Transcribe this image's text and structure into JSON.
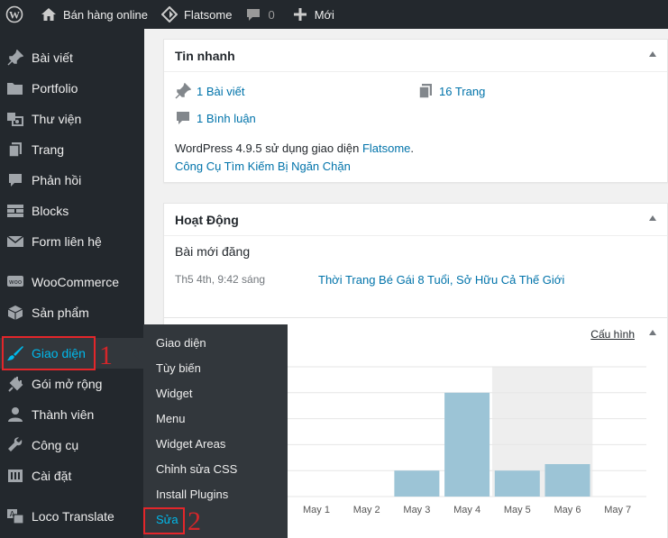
{
  "admin_bar": {
    "site_name": "Bán hàng online",
    "theme": "Flatsome",
    "comments_count": "0",
    "new_label": "Mới"
  },
  "sidebar": {
    "items": [
      {
        "label": "Bài viết",
        "icon": "pin-icon"
      },
      {
        "label": "Portfolio",
        "icon": "folder-icon"
      },
      {
        "label": "Thư viện",
        "icon": "media-icon"
      },
      {
        "label": "Trang",
        "icon": "pages-icon"
      },
      {
        "label": "Phản hồi",
        "icon": "comment-icon"
      },
      {
        "label": "Blocks",
        "icon": "blocks-icon"
      },
      {
        "label": "Form liên hệ",
        "icon": "mail-icon"
      },
      {
        "label": "WooCommerce",
        "icon": "woo-icon"
      },
      {
        "label": "Sản phẩm",
        "icon": "box-icon"
      },
      {
        "label": "Giao diện",
        "icon": "brush-icon"
      },
      {
        "label": "Gói mở rộng",
        "icon": "plugin-icon"
      },
      {
        "label": "Thành viên",
        "icon": "user-icon"
      },
      {
        "label": "Công cụ",
        "icon": "wrench-icon"
      },
      {
        "label": "Cài đặt",
        "icon": "settings-icon"
      },
      {
        "label": "Loco Translate",
        "icon": "translate-icon"
      }
    ]
  },
  "submenu": {
    "items": [
      "Giao diện",
      "Tùy biến",
      "Widget",
      "Menu",
      "Widget Areas",
      "Chỉnh sửa CSS",
      "Install Plugins",
      "Sửa"
    ]
  },
  "glance": {
    "title": "Tin nhanh",
    "posts": "1 Bài viết",
    "pages": "16 Trang",
    "comments": "1 Bình luận",
    "wp_text": "WordPress 4.9.5 sử dụng giao diện",
    "theme_link": "Flatsome",
    "period": ".",
    "search_blocked": "Công Cụ Tìm Kiếm Bị Ngăn Chặn"
  },
  "activity": {
    "title": "Hoạt Động",
    "recent_heading": "Bài mới đăng",
    "post_date": "Th5 4th, 9:42 sáng",
    "post_title": "Thời Trang Bé Gái 8 Tuổi, Sở Hữu Cả Thế Giới"
  },
  "stats": {
    "configure_label": "Cấu hình"
  },
  "annotations": {
    "label_1": "1",
    "label_2": "2"
  },
  "chart_data": {
    "type": "bar",
    "categories": [
      "May 1",
      "May 2",
      "May 3",
      "May 4",
      "May 5",
      "May 6",
      "May 7"
    ],
    "values": [
      0,
      0,
      2,
      8,
      2,
      2.5,
      0
    ],
    "highlight_range": [
      "May 5",
      "May 6"
    ],
    "ylim": [
      0,
      10
    ],
    "bar_color": "#9cc4d6",
    "grid": true
  },
  "colors": {
    "admin_dark": "#23282d",
    "link_blue": "#0073aa",
    "active_blue": "#00b9eb",
    "annotation_red": "#e3262a"
  }
}
